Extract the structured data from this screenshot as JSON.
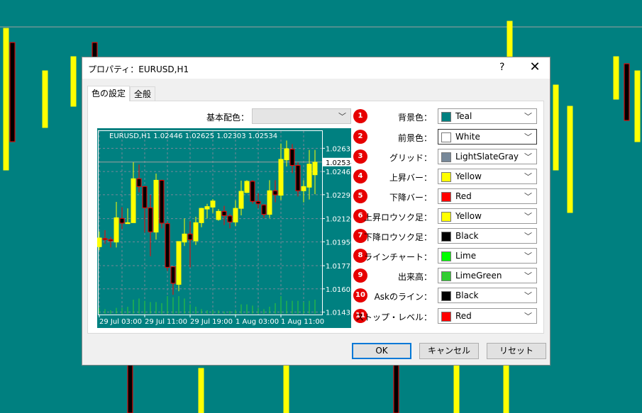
{
  "dialog": {
    "title": "プロパティ：EURUSD,H1",
    "help": "?",
    "close": "✕",
    "tabs": [
      {
        "label": "色の設定",
        "active": true
      },
      {
        "label": "全般",
        "active": false
      }
    ],
    "scheme_label": "基本配色：",
    "scheme_value": "",
    "buttons": {
      "ok": "OK",
      "cancel": "キャンセル",
      "reset": "リセット"
    }
  },
  "colors": [
    {
      "num": "1",
      "label": "背景色：",
      "value": "Teal",
      "hex": "#008080"
    },
    {
      "num": "2",
      "label": "前景色：",
      "value": "White",
      "hex": "#ffffff"
    },
    {
      "num": "3",
      "label": "グリッド：",
      "value": "LightSlateGray",
      "hex": "#778899"
    },
    {
      "num": "4",
      "label": "上昇バー：",
      "value": "Yellow",
      "hex": "#ffff00"
    },
    {
      "num": "5",
      "label": "下降バー：",
      "value": "Red",
      "hex": "#ff0000"
    },
    {
      "num": "6",
      "label": "上昇ロウソク足：",
      "value": "Yellow",
      "hex": "#ffff00"
    },
    {
      "num": "7",
      "label": "下降ロウソク足：",
      "value": "Black",
      "hex": "#000000"
    },
    {
      "num": "8",
      "label": "ラインチャート：",
      "value": "Lime",
      "hex": "#00ff00"
    },
    {
      "num": "9",
      "label": "出来高：",
      "value": "LimeGreen",
      "hex": "#32cd32"
    },
    {
      "num": "10",
      "label": "Askのライン：",
      "value": "Black",
      "hex": "#000000"
    },
    {
      "num": "11",
      "label": "ストップ・レベル：",
      "value": "Red",
      "hex": "#ff0000"
    }
  ],
  "chart_data": {
    "type": "candlestick",
    "title": "EURUSD,H1  1.02446 1.02625 1.02303 1.02534",
    "price_ticks": [
      "1.02635",
      "1.02465",
      "1.02295",
      "1.02120",
      "1.01950",
      "1.01775",
      "1.01605",
      "1.01435"
    ],
    "current_price": "1.02534",
    "time_ticks": [
      "29 Jul 03:00",
      "29 Jul 11:00",
      "29 Jul 19:00",
      "1 Aug 03:00",
      "1 Aug 11:00"
    ],
    "ylim": [
      1.014,
      1.0272
    ],
    "grid": true,
    "ohlc": [
      [
        1.01914,
        1.02026,
        1.01888,
        1.01978
      ],
      [
        1.01974,
        1.02035,
        1.01934,
        1.01966
      ],
      [
        1.01966,
        1.01986,
        1.01908,
        1.01957
      ],
      [
        1.01948,
        1.02242,
        1.01908,
        1.02126
      ],
      [
        1.02121,
        1.02204,
        1.02043,
        1.02087
      ],
      [
        1.02083,
        1.02195,
        1.02083,
        1.0209
      ],
      [
        1.0209,
        1.02533,
        1.0209,
        1.02412
      ],
      [
        1.02412,
        1.02516,
        1.02312,
        1.02355
      ],
      [
        1.02355,
        1.02355,
        1.02017,
        1.02199
      ],
      [
        1.02199,
        1.02294,
        1.01844,
        1.02023
      ],
      [
        1.02021,
        1.0245,
        1.01966,
        1.02401
      ],
      [
        1.02401,
        1.02401,
        1.02048,
        1.02087
      ],
      [
        1.02083,
        1.021,
        1.01737,
        1.01763
      ],
      [
        1.01767,
        1.0177,
        1.01562,
        1.01646
      ],
      [
        1.01638,
        1.01952,
        1.01588,
        1.01952
      ],
      [
        1.01948,
        1.02121,
        1.01919,
        1.02007
      ],
      [
        1.02007,
        1.021,
        1.01763,
        1.01966
      ],
      [
        1.01957,
        1.02133,
        1.01927,
        1.0209
      ],
      [
        1.0209,
        1.02199,
        1.02057,
        1.02195
      ],
      [
        1.0219,
        1.02228,
        1.02121,
        1.02208
      ],
      [
        1.02204,
        1.02263,
        1.02161,
        1.02249
      ],
      [
        1.02113,
        1.0219,
        1.02104,
        1.02173
      ],
      [
        1.02173,
        1.02213,
        1.02073,
        1.02142
      ],
      [
        1.02139,
        1.02156,
        1.02048,
        1.02095
      ],
      [
        1.02095,
        1.02254,
        1.02066,
        1.02195
      ],
      [
        1.02195,
        1.02398,
        1.02144,
        1.0232
      ],
      [
        1.02311,
        1.02401,
        1.02308,
        1.02393
      ],
      [
        1.02393,
        1.02401,
        1.02228,
        1.02246
      ],
      [
        1.02246,
        1.02306,
        1.02195,
        1.02228
      ],
      [
        1.0222,
        1.02225,
        1.02125,
        1.02151
      ],
      [
        1.02151,
        1.02401,
        1.02125,
        1.02324
      ],
      [
        1.02324,
        1.02401,
        1.02239,
        1.02294
      ],
      [
        1.02291,
        1.0267,
        1.02256,
        1.02554
      ],
      [
        1.0255,
        1.02692,
        1.02502,
        1.02632
      ],
      [
        1.02628,
        1.02666,
        1.02453,
        1.0251
      ],
      [
        1.0251,
        1.02533,
        1.02282,
        1.02324
      ],
      [
        1.02324,
        1.02401,
        1.02239,
        1.02355
      ],
      [
        1.0235,
        1.02623,
        1.0226,
        1.02519
      ],
      [
        1.02441,
        1.02623,
        1.02299,
        1.02533
      ]
    ],
    "volume": [
      25,
      20,
      15,
      25,
      25,
      30,
      60,
      65,
      55,
      50,
      50,
      45,
      75,
      70,
      75,
      65,
      40,
      30,
      20,
      15,
      15,
      15,
      10,
      12,
      15,
      40,
      40,
      35,
      25,
      20,
      30,
      45,
      75,
      55,
      55,
      55,
      50,
      55,
      60
    ]
  }
}
